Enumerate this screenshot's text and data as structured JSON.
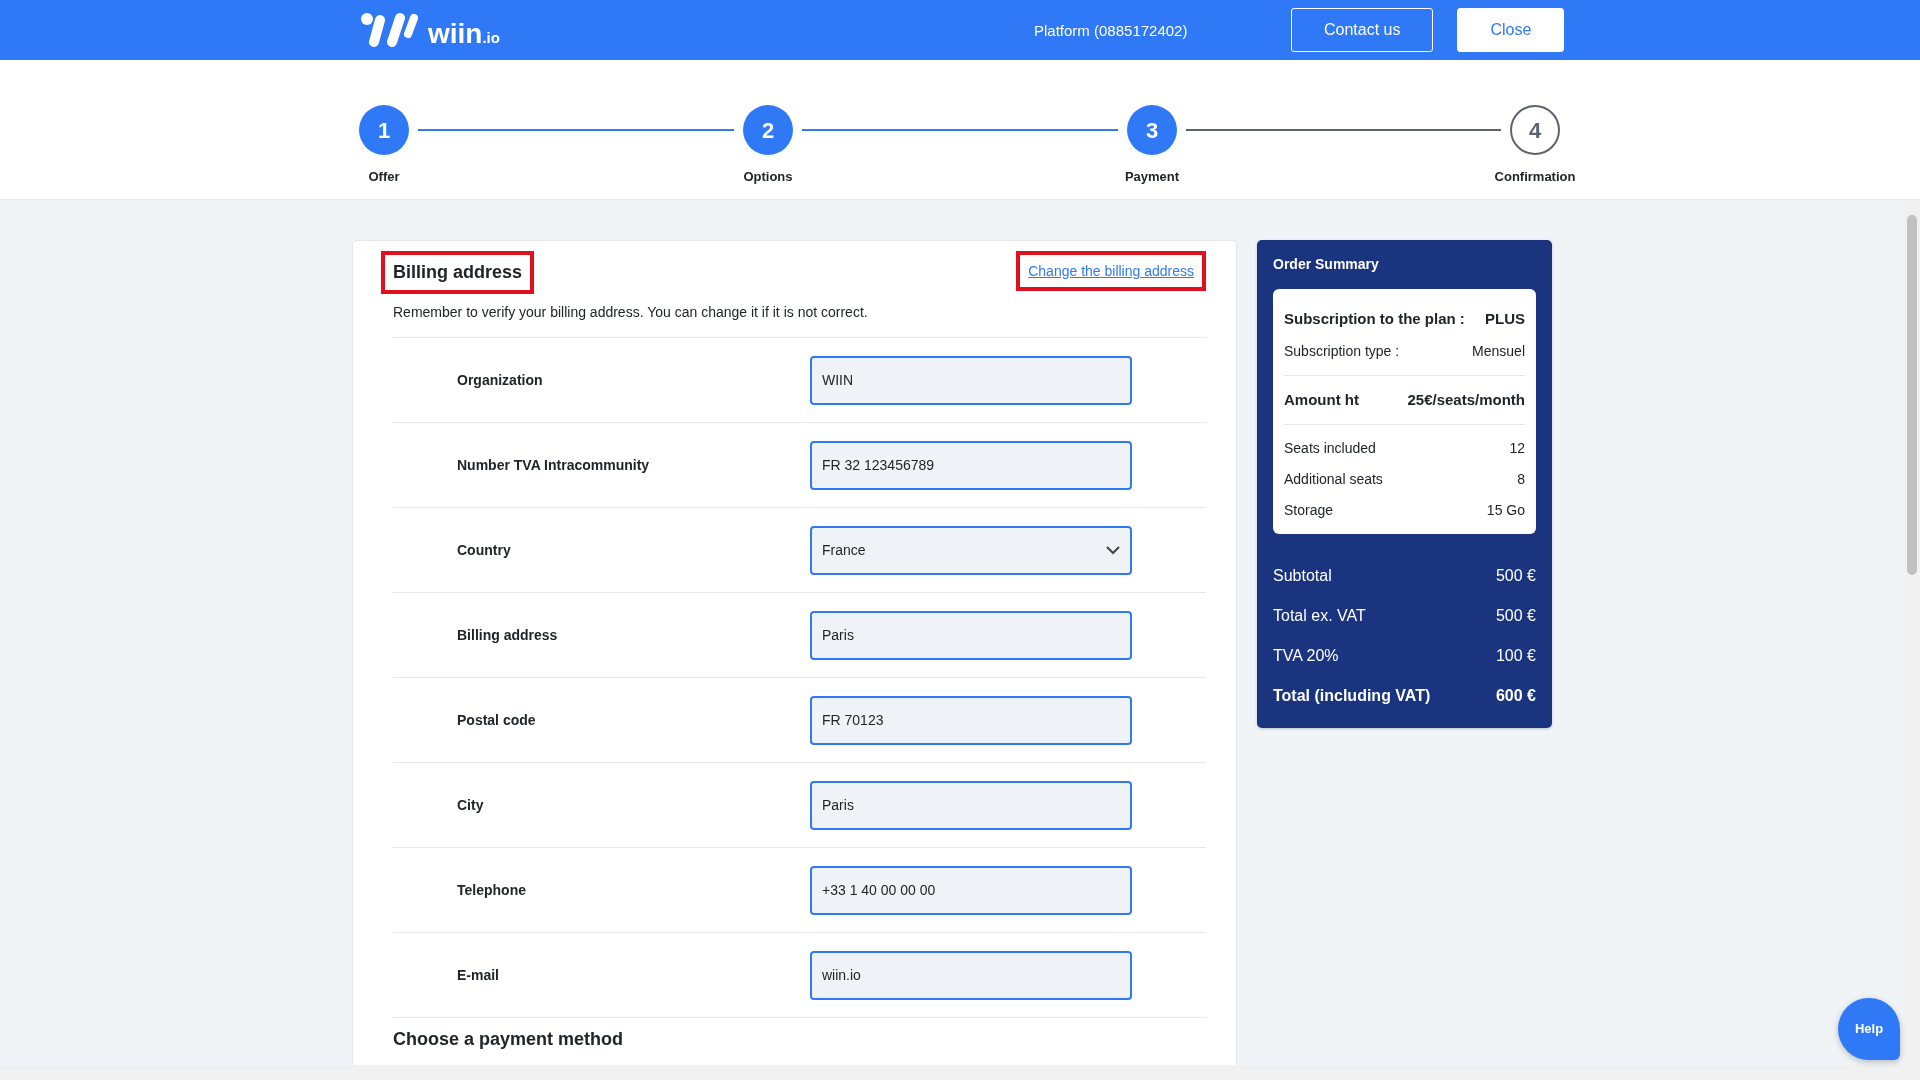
{
  "header": {
    "logo": {
      "name": "wiin",
      "suffix": ".io"
    },
    "platform": "Platform (0885172402)",
    "buttons": [
      {
        "label": "Contact us",
        "kind": "outline"
      },
      {
        "label": "Close",
        "kind": "solid"
      }
    ]
  },
  "steps": [
    {
      "number": "1",
      "label": "Offer",
      "done": true
    },
    {
      "number": "2",
      "label": "Options",
      "done": true
    },
    {
      "number": "3",
      "label": "Payment",
      "done": true
    },
    {
      "number": "4",
      "label": "Confirmation",
      "done": false
    }
  ],
  "billing": {
    "title": "Billing address",
    "title_highlighted": true,
    "change_link": "Change the billing address",
    "link_highlighted": true,
    "note": "Remember to verify your billing address. You can change it if it is not correct.",
    "fields": [
      {
        "label": "Organization",
        "kind": "text",
        "value": "WIIN"
      },
      {
        "label": "Number TVA Intracommunity",
        "kind": "text",
        "value": "FR 32 123456789"
      },
      {
        "label": "Country",
        "kind": "select",
        "value": "France"
      },
      {
        "label": "Billing address",
        "kind": "text",
        "value": "Paris"
      },
      {
        "label": "Postal code",
        "kind": "text",
        "value": "FR 70123"
      },
      {
        "label": "City",
        "kind": "text",
        "value": "Paris"
      },
      {
        "label": "Telephone",
        "kind": "text",
        "value": "+33 1 40 00 00 00"
      },
      {
        "label": "E-mail",
        "kind": "text",
        "value": "wiin.io"
      }
    ],
    "next_section": "Choose a payment method"
  },
  "summary": {
    "title": "Order Summary",
    "plan": [
      {
        "label": "Subscription to the plan :",
        "value": "PLUS",
        "kind": "strong"
      },
      {
        "label": "Subscription type :",
        "value": "Mensuel",
        "kind": "plain"
      },
      {
        "kind": "divider"
      },
      {
        "label": "Amount ht",
        "value": "25€/seats/month",
        "kind": "strong"
      },
      {
        "kind": "divider"
      },
      {
        "label": "Seats included",
        "value": "12",
        "kind": "plain"
      },
      {
        "label": "Additional seats",
        "value": "8",
        "kind": "plain"
      },
      {
        "label": "Storage",
        "value": "15 Go",
        "kind": "plain"
      }
    ],
    "totals": [
      {
        "label": "Subtotal",
        "value": "500 €",
        "kind": "plain"
      },
      {
        "label": "Total ex. VAT",
        "value": "500 €",
        "kind": "plain"
      },
      {
        "label": "TVA 20%",
        "value": "100 €",
        "kind": "plain"
      },
      {
        "label": "Total (including VAT)",
        "value": "600 €",
        "kind": "strong"
      }
    ]
  },
  "help_button": "Help"
}
